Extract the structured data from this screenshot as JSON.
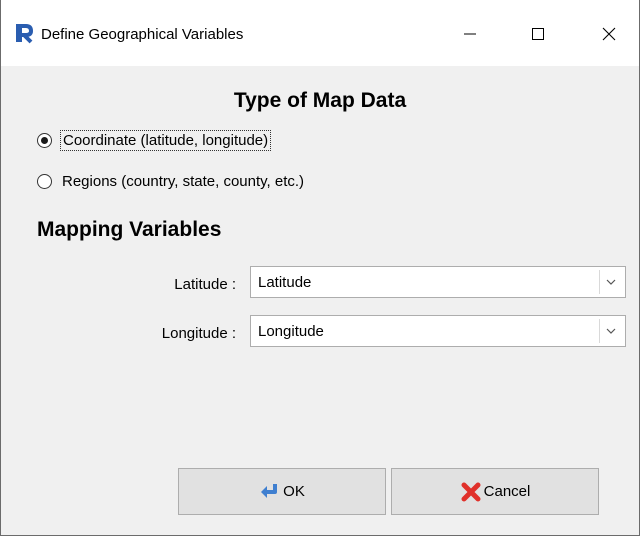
{
  "window": {
    "title": "Define Geographical Variables",
    "app_icon": "r-logo-icon"
  },
  "map_type": {
    "heading": "Type of Map Data",
    "options": [
      {
        "label": "Coordinate (latitude, longitude)",
        "selected": true
      },
      {
        "label": "Regions (country, state, county, etc.)",
        "selected": false
      }
    ]
  },
  "mapping": {
    "heading": "Mapping Variables",
    "latitude": {
      "label": "Latitude :",
      "value": "Latitude"
    },
    "longitude": {
      "label": "Longitude :",
      "value": "Longitude"
    }
  },
  "buttons": {
    "ok": {
      "label": "OK",
      "icon": "return-arrow-icon"
    },
    "cancel": {
      "label": "Cancel",
      "icon": "red-x-icon"
    }
  },
  "colors": {
    "r_logo": "#2a5db0",
    "cancel_x": "#e0302a",
    "ok_arrow": "#3f7fd0"
  }
}
